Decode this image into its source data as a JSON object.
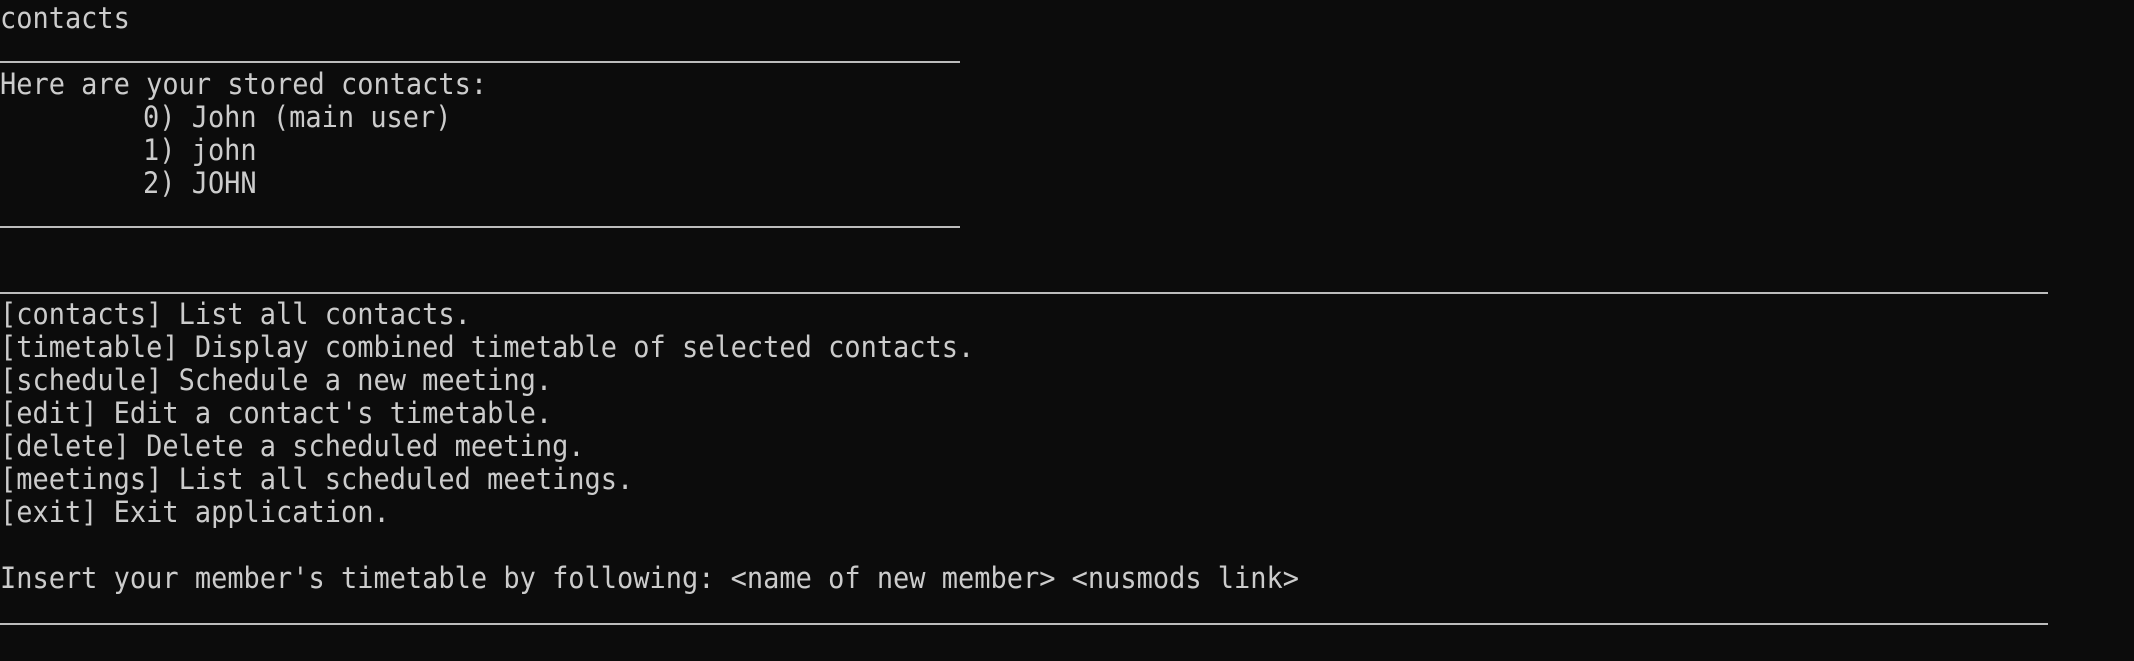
{
  "terminal": {
    "command": "contacts",
    "contacts_header": "Here are your stored contacts:",
    "contacts": [
      "0) John (main user)",
      "1) john",
      "2) JOHN"
    ],
    "menu": [
      "[contacts] List all contacts.",
      "[timetable] Display combined timetable of selected contacts.",
      "[schedule] Schedule a new meeting.",
      "[edit] Edit a contact's timetable.",
      "[delete] Delete a scheduled meeting.",
      "[meetings] List all scheduled meetings.",
      "[exit] Exit application."
    ],
    "prompt": "Insert your member's timetable by following: <name of new member> <nusmods link>"
  },
  "colors": {
    "background": "#0c0c0c",
    "text": "#cccccc",
    "divider": "#bdbdbd"
  }
}
